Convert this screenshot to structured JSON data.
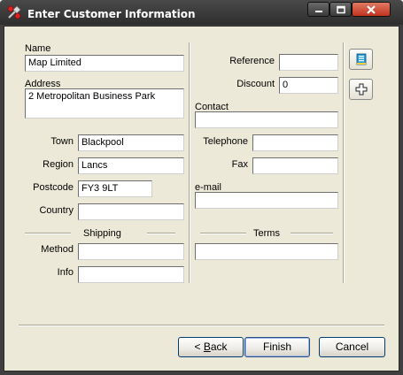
{
  "window": {
    "title": "Enter Customer Information",
    "icons": [
      "app-icon",
      "minimize-icon",
      "maximize-icon",
      "close-icon"
    ]
  },
  "left": {
    "name_label": "Name",
    "name_value": "Map Limited",
    "address_label": "Address",
    "address_value": "2 Metropolitan Business Park",
    "town_label": "Town",
    "town_value": "Blackpool",
    "region_label": "Region",
    "region_value": "Lancs",
    "postcode_label": "Postcode",
    "postcode_value": "FY3 9LT",
    "country_label": "Country",
    "country_value": "",
    "shipping_label": "Shipping",
    "method_label": "Method",
    "method_value": "",
    "info_label": "Info",
    "info_value": ""
  },
  "right": {
    "reference_label": "Reference",
    "reference_value": "",
    "discount_label": "Discount",
    "discount_value": "0",
    "contact_label": "Contact",
    "contact_value": "",
    "telephone_label": "Telephone",
    "telephone_value": "",
    "fax_label": "Fax",
    "fax_value": "",
    "email_label": "e-mail",
    "email_value": "",
    "terms_label": "Terms",
    "terms_value": ""
  },
  "side_buttons": {
    "icons": [
      "notes-icon",
      "add-icon"
    ]
  },
  "footer": {
    "back_prefix": "< ",
    "back_hotkey": "B",
    "back_rest": "ack",
    "finish_label": "Finish",
    "cancel_label": "Cancel"
  }
}
